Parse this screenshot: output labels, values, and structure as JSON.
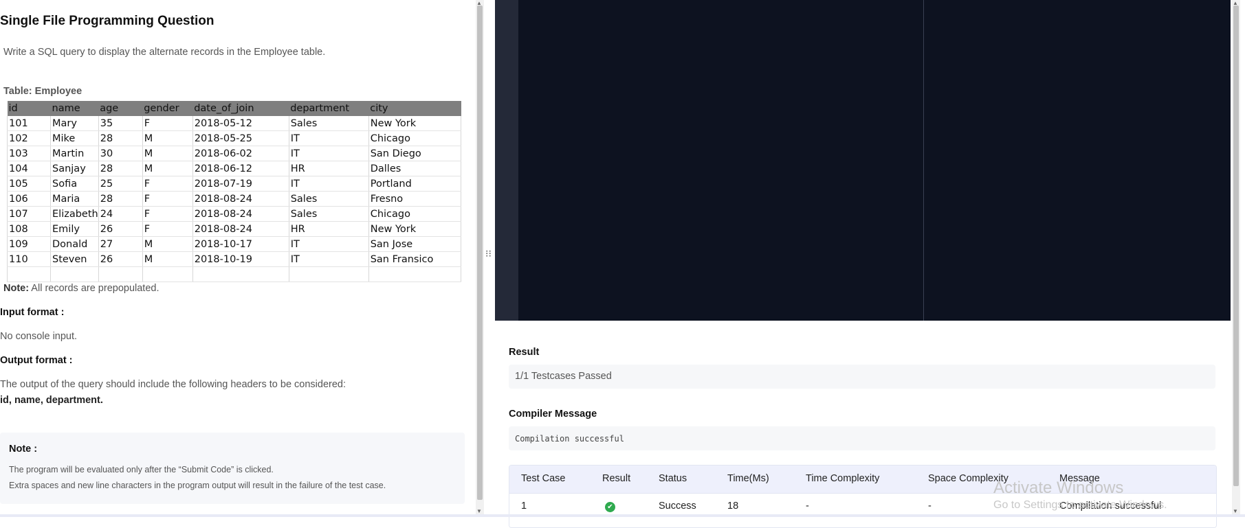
{
  "question": {
    "title": "Single File Programming Question",
    "prompt": "Write a SQL query to display the alternate records in the Employee table.",
    "table_label": "Table: Employee",
    "columns": [
      "id",
      "name",
      "age",
      "gender",
      "date_of_join",
      "department",
      "city"
    ],
    "rows": [
      [
        "101",
        "Mary",
        "35",
        "F",
        "2018-05-12",
        "Sales",
        "New York"
      ],
      [
        "102",
        "Mike",
        "28",
        "M",
        "2018-05-25",
        "IT",
        "Chicago"
      ],
      [
        "103",
        "Martin",
        "30",
        "M",
        "2018-06-02",
        "IT",
        "San Diego"
      ],
      [
        "104",
        "Sanjay",
        "28",
        "M",
        "2018-06-12",
        "HR",
        "Dalles"
      ],
      [
        "105",
        "Sofia",
        "25",
        "F",
        "2018-07-19",
        "IT",
        "Portland"
      ],
      [
        "106",
        "Maria",
        "28",
        "F",
        "2018-08-24",
        "Sales",
        "Fresno"
      ],
      [
        "107",
        "Elizabeth",
        "24",
        "F",
        "2018-08-24",
        "Sales",
        "Chicago"
      ],
      [
        "108",
        "Emily",
        "26",
        "F",
        "2018-08-24",
        "HR",
        "New York"
      ],
      [
        "109",
        "Donald",
        "27",
        "M",
        "2018-10-17",
        "IT",
        "San Jose"
      ],
      [
        "110",
        "Steven",
        "26",
        "M",
        "2018-10-19",
        "IT",
        "San Fransico"
      ],
      [
        "",
        "",
        "",
        "",
        "",
        "",
        ""
      ]
    ],
    "note_label": "Note:",
    "note_text": "All records are prepopulated.",
    "input_format_heading": "Input format :",
    "input_format_text": "No console input.",
    "output_format_heading": "Output format :",
    "output_format_text": "The output of the query should include the following headers to be considered:",
    "output_format_bold": "id, name, department.",
    "notebox": {
      "heading": "Note :",
      "line1": "The program will be evaluated only after the “Submit Code” is clicked.",
      "line2": "Extra spaces and new line characters in the program output will result in the failure of the test case."
    }
  },
  "results": {
    "result_heading": "Result",
    "result_value": "1/1 Testcases Passed",
    "compiler_heading": "Compiler Message",
    "compiler_value": "Compilation successful",
    "testcase_headers": [
      "Test Case",
      "Result",
      "Status",
      "Time(Ms)",
      "Time Complexity",
      "Space Complexity",
      "Message"
    ],
    "testcase_row": {
      "test_case": "1",
      "result_icon": "check-circle-icon",
      "status": "Success",
      "time_ms": "18",
      "time_complexity": "-",
      "space_complexity": "-",
      "message": "Compilation successful"
    }
  },
  "watermark": {
    "line1": "Activate Windows",
    "line2": "Go to Settings to activate Windows."
  },
  "icons": {
    "drag_handle": "drag-handle-icon",
    "scroll_up": "scroll-up-arrow-icon",
    "scroll_down": "scroll-down-arrow-icon"
  },
  "colors": {
    "editor_bg": "#0d1220",
    "editor_gutter": "#242938",
    "table_header": "#7f7f7f",
    "success": "#2faa4f",
    "testcase_header_bg": "#eef0fc"
  }
}
